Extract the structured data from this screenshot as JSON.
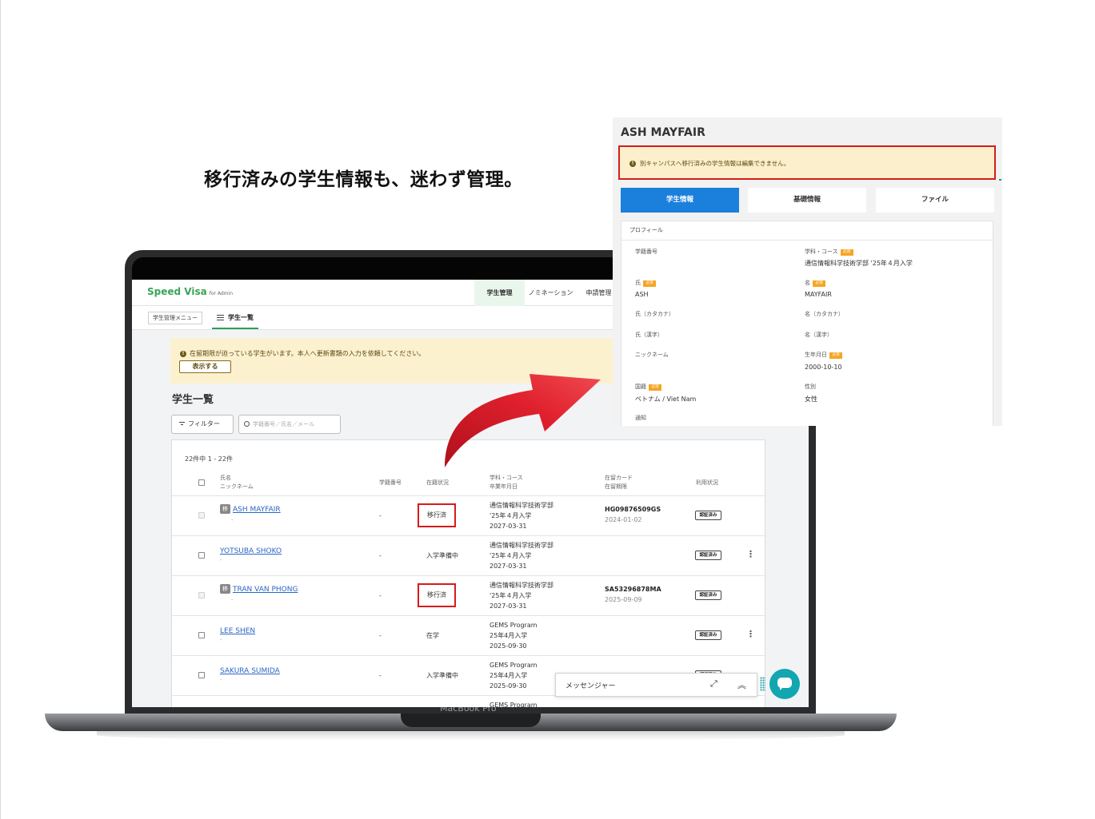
{
  "headline": "移行済みの学生情報も、迷わず管理。",
  "device_label": "MacBook Pro",
  "app": {
    "logo": "Speed Visa",
    "logo_sub": "for Admin",
    "nav_tabs": [
      "学生管理",
      "ノミネーション",
      "申請管理"
    ],
    "sub_menu_button": "学生管理メニュー",
    "sub_tab": "学生一覧",
    "alert": {
      "icon": "info-icon",
      "text": "在留期限が迫っている学生がいます。本人へ更新書類の入力を依頼してください。",
      "button": "表示する"
    },
    "list_title": "学生一覧",
    "filter_button": "フィルター",
    "search_placeholder": "学籍番号／氏名／メール",
    "count_text": "22件中 1 - 22件",
    "columns": {
      "name": [
        "氏名",
        "ニックネーム"
      ],
      "student_no": "学籍番号",
      "enrollment": "在籍状況",
      "course": [
        "学科・コース",
        "卒業年月日"
      ],
      "card": [
        "在留カード",
        "在留期限"
      ],
      "usage": "利用状況"
    },
    "rows": [
      {
        "tag": "移",
        "name": "ASH MAYFAIR",
        "nickname": "-",
        "student_no": "-",
        "status": "移行済",
        "course": "通信情報科学技術学部",
        "entry": "'25年４月入学",
        "graduation": "2027-03-31",
        "card_no": "HG09876509GS",
        "card_exp": "2024-01-02",
        "usage": "認証済み"
      },
      {
        "tag": "",
        "name": "YOTSUBA SHOKO",
        "nickname": "-",
        "student_no": "-",
        "status": "入学準備中",
        "course": "通信情報科学技術学部",
        "entry": "'25年４月入学",
        "graduation": "2027-03-31",
        "card_no": "",
        "card_exp": "",
        "usage": "認証済み"
      },
      {
        "tag": "移",
        "name": "TRAN VAN PHONG",
        "nickname": "-",
        "student_no": "-",
        "status": "移行済",
        "course": "通信情報科学技術学部",
        "entry": "'25年４月入学",
        "graduation": "2027-03-31",
        "card_no": "SA53296878MA",
        "card_exp": "2025-09-09",
        "usage": "認証済み"
      },
      {
        "tag": "",
        "name": "LEE SHEN",
        "nickname": "-",
        "student_no": "-",
        "status": "在学",
        "course": "GEMS Program",
        "entry": "25年4月入学",
        "graduation": "2025-09-30",
        "card_no": "",
        "card_exp": "",
        "usage": "認証済み"
      },
      {
        "tag": "",
        "name": "SAKURA SUMIDA",
        "nickname": "-",
        "student_no": "-",
        "status": "入学準備中",
        "course": "GEMS Program",
        "entry": "25年4月入学",
        "graduation": "2025-09-30",
        "card_no": "",
        "card_exp": "",
        "usage": "認証済み"
      },
      {
        "tag": "",
        "name": "",
        "nickname": "",
        "student_no": "",
        "status": "",
        "course": "GEMS Program",
        "entry": "",
        "graduation": "",
        "card_no": "",
        "card_exp": "",
        "usage": ""
      }
    ],
    "messenger": {
      "label": "メッセンジャー",
      "expand_icon": "expand-icon",
      "collapse_icon": "chevron-double-up-icon"
    }
  },
  "detail": {
    "title": "ASH MAYFAIR",
    "alert_text": "別キャンパスへ移行済みの学生情報は編集できません。",
    "tabs": [
      "学生情報",
      "基礎情報",
      "ファイル"
    ],
    "section": "プロフィール",
    "required_label": "必須",
    "fields": {
      "student_no": {
        "label": "学籍番号",
        "value": ""
      },
      "course": {
        "label": "学科・コース",
        "value": "通信情報科学技術学部 '25年４月入学"
      },
      "last_name": {
        "label": "氏",
        "value": "ASH"
      },
      "first_name": {
        "label": "名",
        "value": "MAYFAIR"
      },
      "last_kana": {
        "label": "氏（カタカナ）",
        "value": ""
      },
      "first_kana": {
        "label": "名（カタカナ）",
        "value": ""
      },
      "last_kanji": {
        "label": "氏（漢字）",
        "value": ""
      },
      "first_kanji": {
        "label": "名（漢字）",
        "value": ""
      },
      "nickname": {
        "label": "ニックネーム",
        "value": ""
      },
      "birthday": {
        "label": "生年月日",
        "value": "2000-10-10"
      },
      "nationality": {
        "label": "国籍",
        "value": "ベトナム / Viet Nam"
      },
      "gender": {
        "label": "性別",
        "value": "女性"
      },
      "notice": {
        "label": "通知",
        "value": ""
      }
    }
  },
  "colors": {
    "brand_green": "#3aa458",
    "link_blue": "#2b66c4",
    "highlight_red": "#d61b1b",
    "alert_bg": "#fcf1cf",
    "tab_active": "#1b7fdc",
    "chat_teal": "#12a6b0"
  }
}
